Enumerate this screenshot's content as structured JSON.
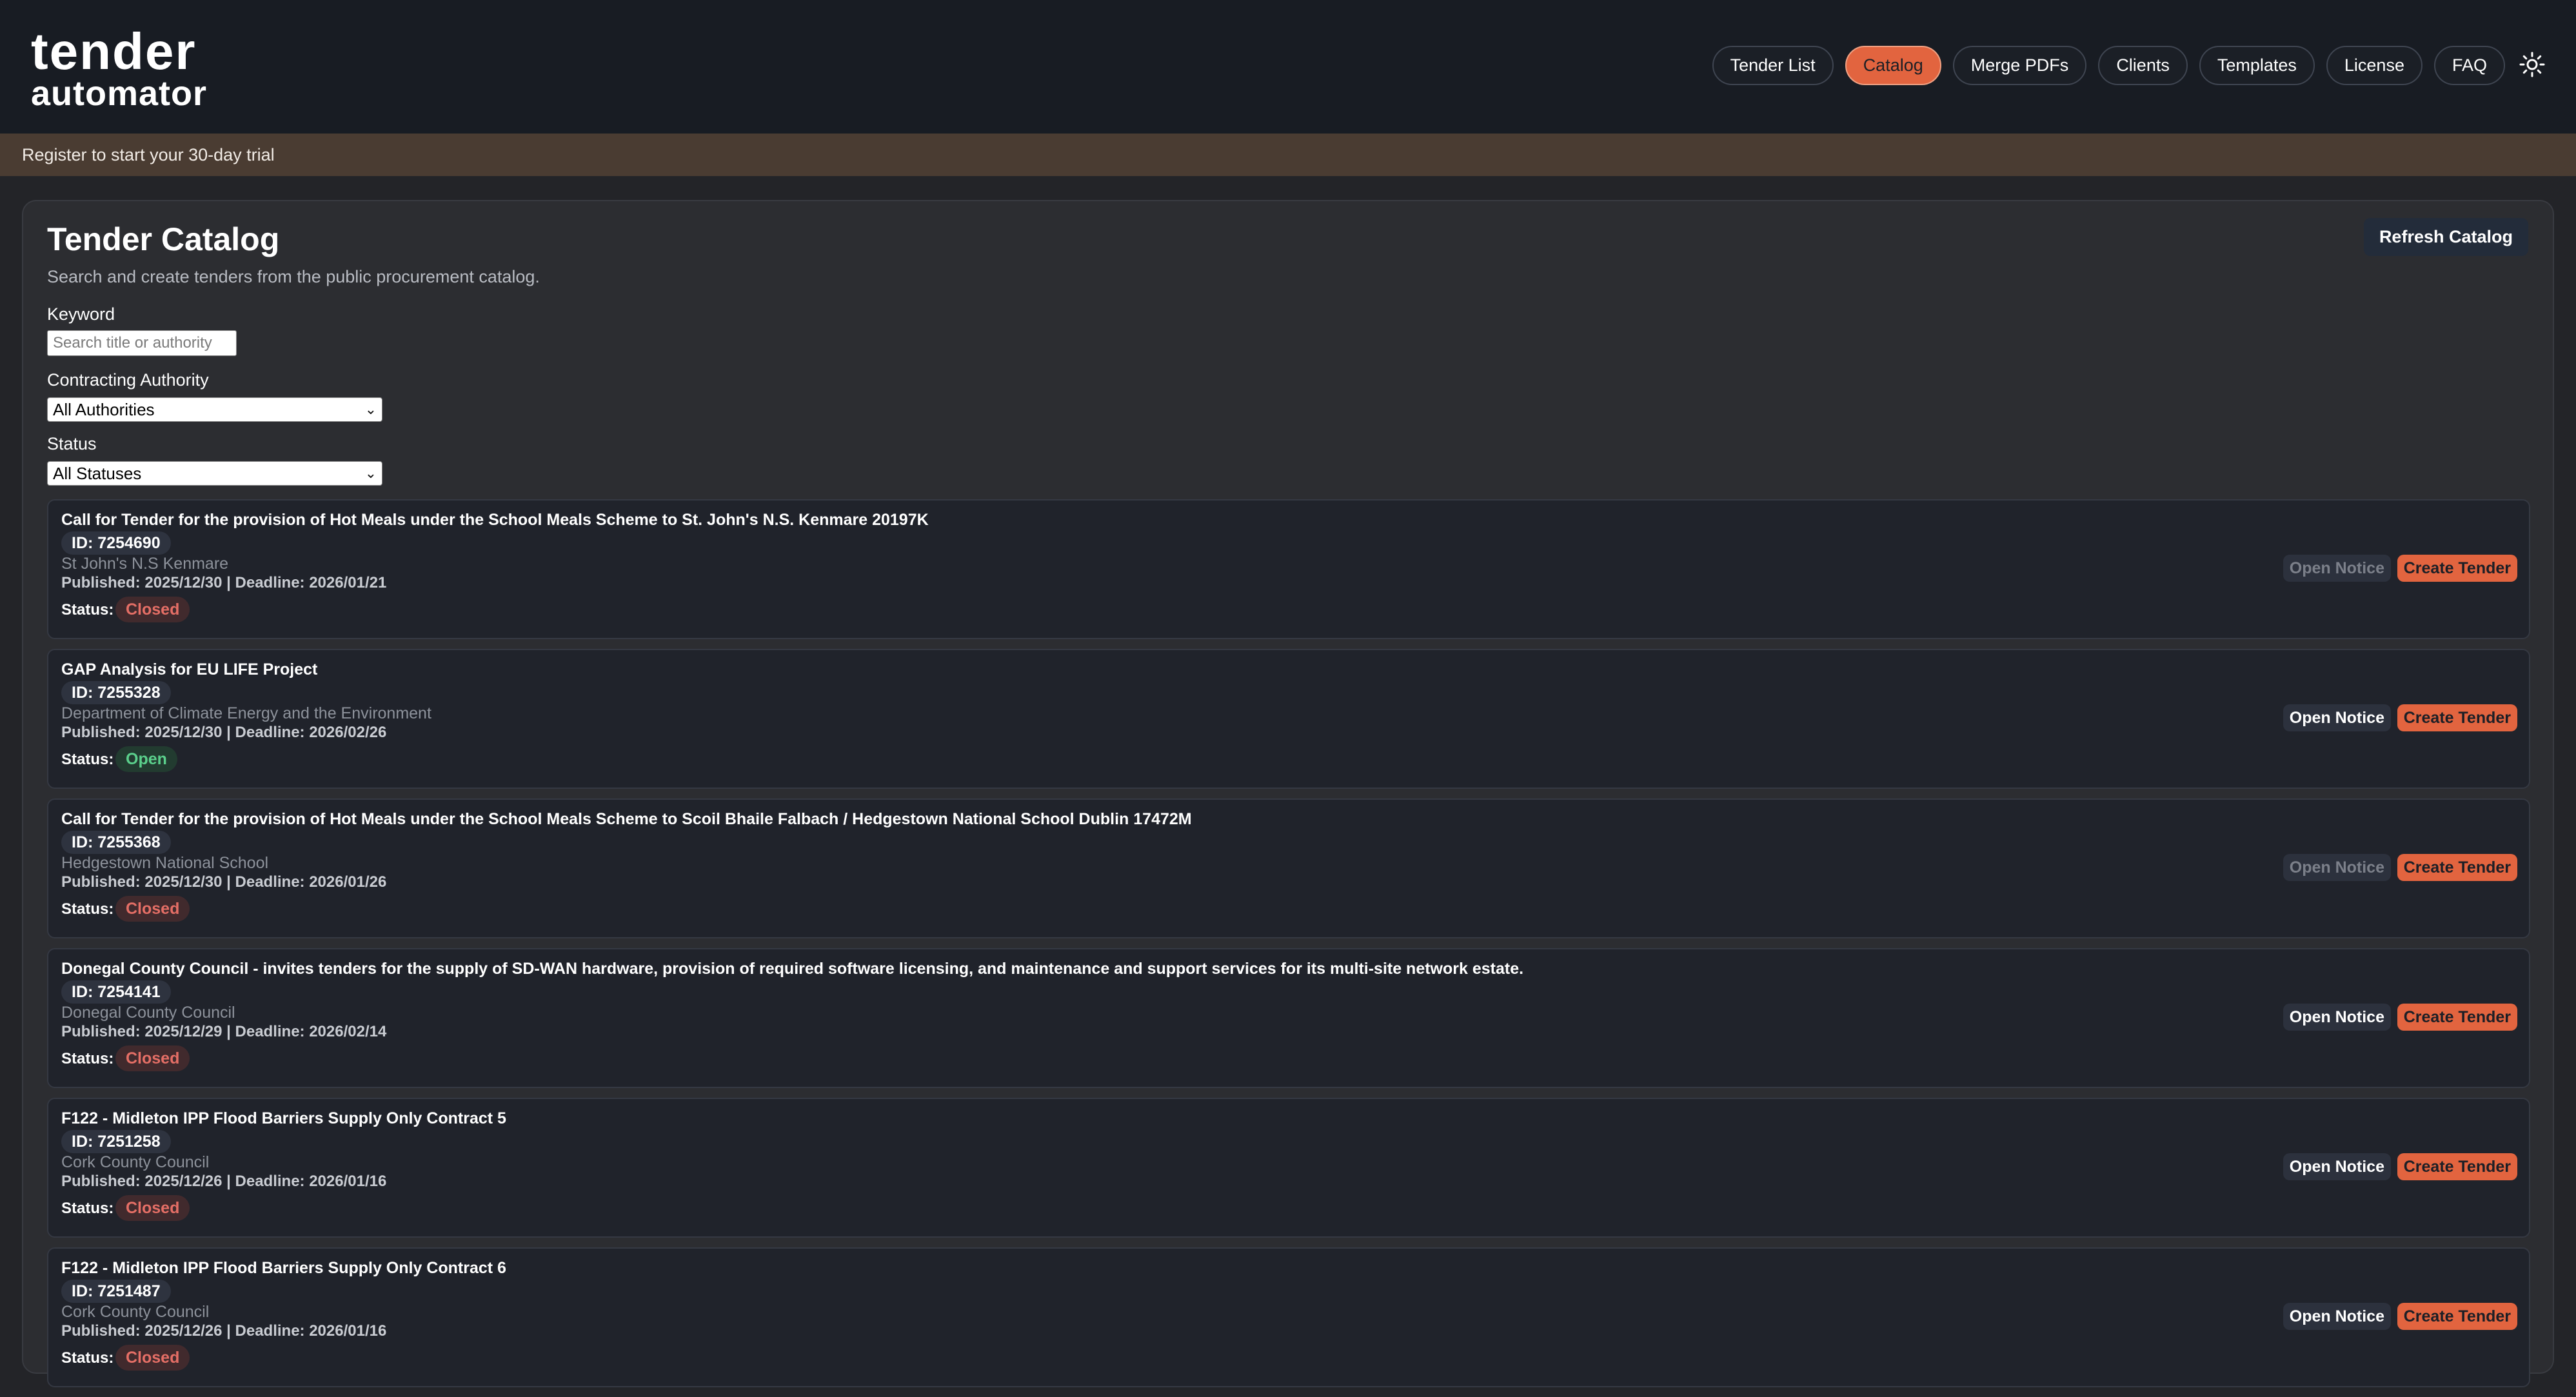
{
  "brand": {
    "line1": "tender",
    "line2": "automator"
  },
  "nav": {
    "items": [
      "Tender List",
      "Catalog",
      "Merge PDFs",
      "Clients",
      "Templates",
      "License",
      "FAQ"
    ],
    "active": "Catalog",
    "theme_icon": "sun-icon"
  },
  "banner": {
    "text": "Register to start your 30-day trial"
  },
  "catalog": {
    "title": "Tender Catalog",
    "subtitle": "Search and create tenders from the public procurement catalog.",
    "refresh_label": "Refresh Catalog"
  },
  "filters": {
    "keyword_label": "Keyword",
    "keyword_placeholder": "Search title or authority",
    "keyword_value": "",
    "authority_label": "Contracting Authority",
    "authority_value": "All Authorities",
    "status_label": "Status",
    "status_value": "All Statuses"
  },
  "labels": {
    "status": "Status:",
    "open_notice": "Open Notice",
    "create_tender": "Create Tender"
  },
  "colors": {
    "accent": "#e2643f",
    "closed": "#e56f66",
    "open": "#5bd08c"
  },
  "tenders": [
    {
      "title": "Call for Tender for the provision of Hot Meals under the School Meals Scheme to St. John's N.S. Kenmare 20197K",
      "id": "ID: 7254690",
      "authority": "St John's N.S Kenmare",
      "dates": "Published: 2025/12/30 | Deadline: 2026/01/21",
      "status": "Closed",
      "notice_enabled": false
    },
    {
      "title": "GAP Analysis for EU LIFE Project",
      "id": "ID: 7255328",
      "authority": "Department of Climate Energy and the Environment",
      "dates": "Published: 2025/12/30 | Deadline: 2026/02/26",
      "status": "Open",
      "notice_enabled": true
    },
    {
      "title": "Call for Tender for the provision of Hot Meals under the School Meals Scheme to Scoil Bhaile Falbach / Hedgestown National School Dublin 17472M",
      "id": "ID: 7255368",
      "authority": "Hedgestown National School",
      "dates": "Published: 2025/12/30 | Deadline: 2026/01/26",
      "status": "Closed",
      "notice_enabled": false
    },
    {
      "title": "Donegal County Council - invites tenders for the supply of SD-WAN hardware, provision of required software licensing, and maintenance and support services for its multi-site network estate.",
      "id": "ID: 7254141",
      "authority": "Donegal County Council",
      "dates": "Published: 2025/12/29 | Deadline: 2026/02/14",
      "status": "Closed",
      "notice_enabled": true
    },
    {
      "title": "F122 - Midleton IPP Flood Barriers Supply Only Contract 5",
      "id": "ID: 7251258",
      "authority": "Cork County Council",
      "dates": "Published: 2025/12/26 | Deadline: 2026/01/16",
      "status": "Closed",
      "notice_enabled": true
    },
    {
      "title": "F122 - Midleton IPP Flood Barriers Supply Only Contract 6",
      "id": "ID: 7251487",
      "authority": "Cork County Council",
      "dates": "Published: 2025/12/26 | Deadline: 2026/01/16",
      "status": "Closed",
      "notice_enabled": true
    }
  ]
}
